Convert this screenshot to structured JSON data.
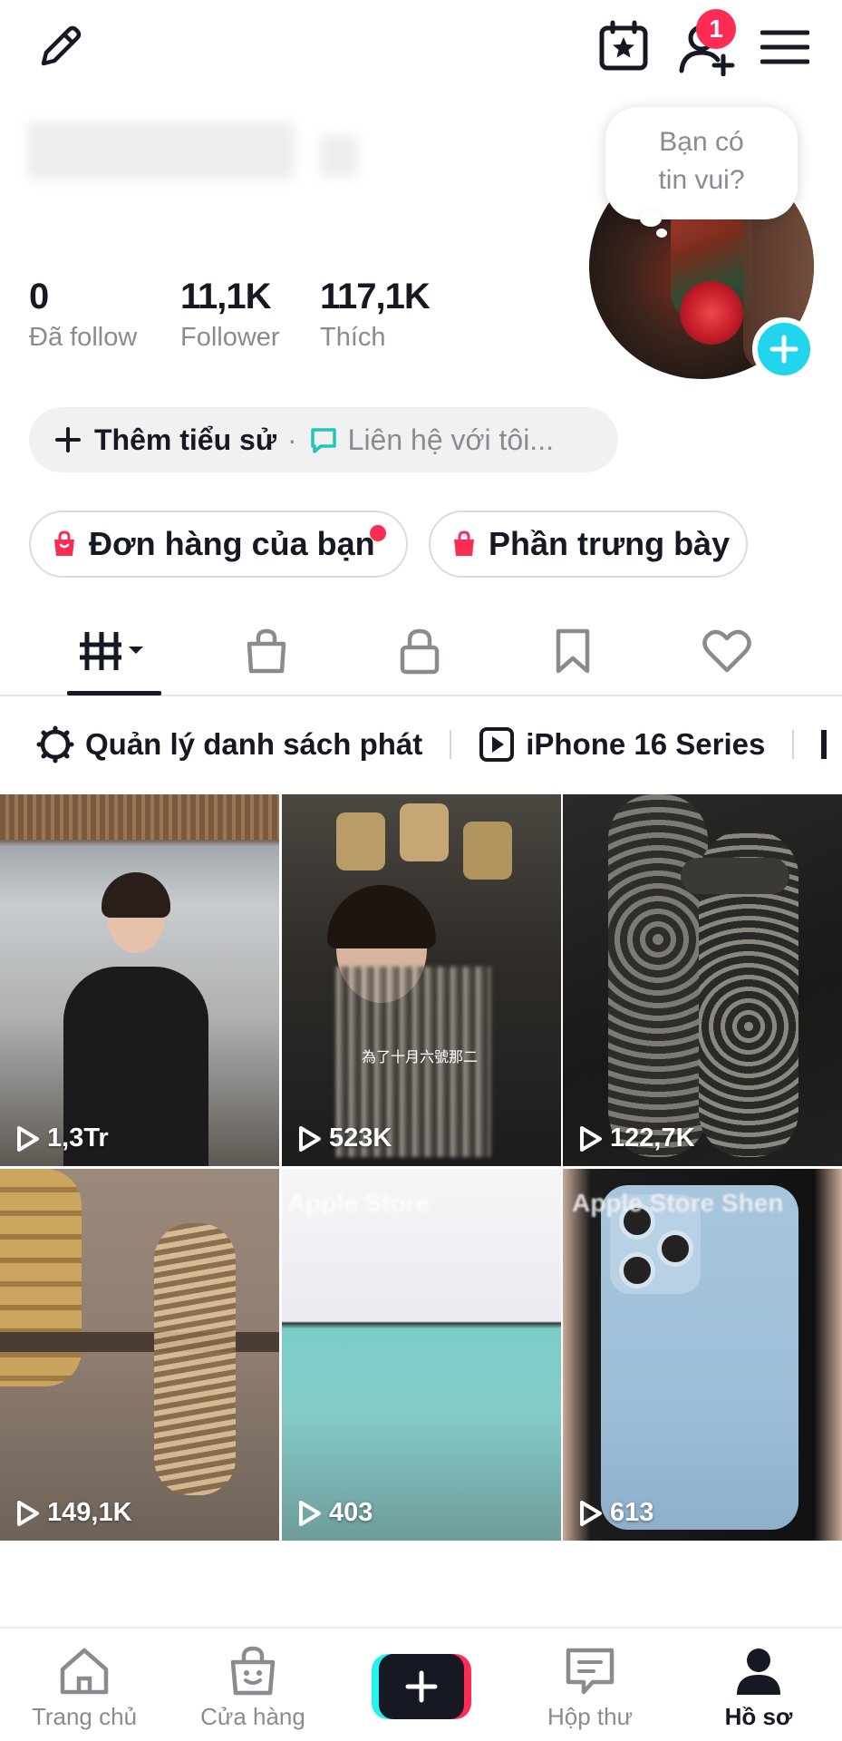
{
  "header": {
    "edit_icon": "pencil-icon",
    "calendar_icon": "calendar-star-icon",
    "add_friend_icon": "add-user-icon",
    "friend_badge": "1",
    "menu_icon": "hamburger-icon"
  },
  "profile": {
    "bubble_text_line1": "Bạn có",
    "bubble_text_line2": "tin vui?",
    "stats": [
      {
        "value": "0",
        "label": "Đã follow"
      },
      {
        "value": "11,1K",
        "label": "Follower"
      },
      {
        "value": "117,1K",
        "label": "Thích"
      }
    ],
    "add_bio": "Thêm tiểu sử",
    "separator": "·",
    "contact": "Liên hệ với tôi..."
  },
  "shop_chips": [
    {
      "label": "Đơn hàng của bạn",
      "has_dot": true
    },
    {
      "label": "Phần trưng bày",
      "has_dot": false
    }
  ],
  "tabs": [
    {
      "name": "videos",
      "icon": "grid-icon",
      "active": true
    },
    {
      "name": "shop",
      "icon": "shopping-bag-icon",
      "active": false
    },
    {
      "name": "private",
      "icon": "lock-icon",
      "active": false
    },
    {
      "name": "favorites",
      "icon": "bookmark-icon",
      "active": false
    },
    {
      "name": "liked",
      "icon": "heart-icon",
      "active": false
    }
  ],
  "playlists": {
    "manage_label": "Quản lý danh sách phát",
    "playlist_1": "iPhone 16 Series"
  },
  "videos": [
    {
      "views": "1,3Tr"
    },
    {
      "views": "523K"
    },
    {
      "views": "122,7K"
    },
    {
      "views": "149,1K"
    },
    {
      "views": "403"
    },
    {
      "views": "613"
    }
  ],
  "video_overlay_texts": {
    "v2_caption": "為了十月六號那二",
    "v5_banner": "Apple Store",
    "v6_banner": "Apple Store   Shen"
  },
  "bottom_nav": [
    {
      "label": "Trang chủ",
      "icon": "home-icon",
      "active": false
    },
    {
      "label": "Cửa hàng",
      "icon": "shop-bag-icon",
      "active": false
    },
    {
      "label": "",
      "icon": "plus-icon",
      "active": false
    },
    {
      "label": "Hộp thư",
      "icon": "inbox-icon",
      "active": false
    },
    {
      "label": "Hồ sơ",
      "icon": "profile-icon",
      "active": true
    }
  ],
  "colors": {
    "accent_red": "#fe2c55",
    "accent_cyan": "#20d5ec",
    "text_primary": "#161823",
    "text_secondary": "#8a8b91"
  }
}
